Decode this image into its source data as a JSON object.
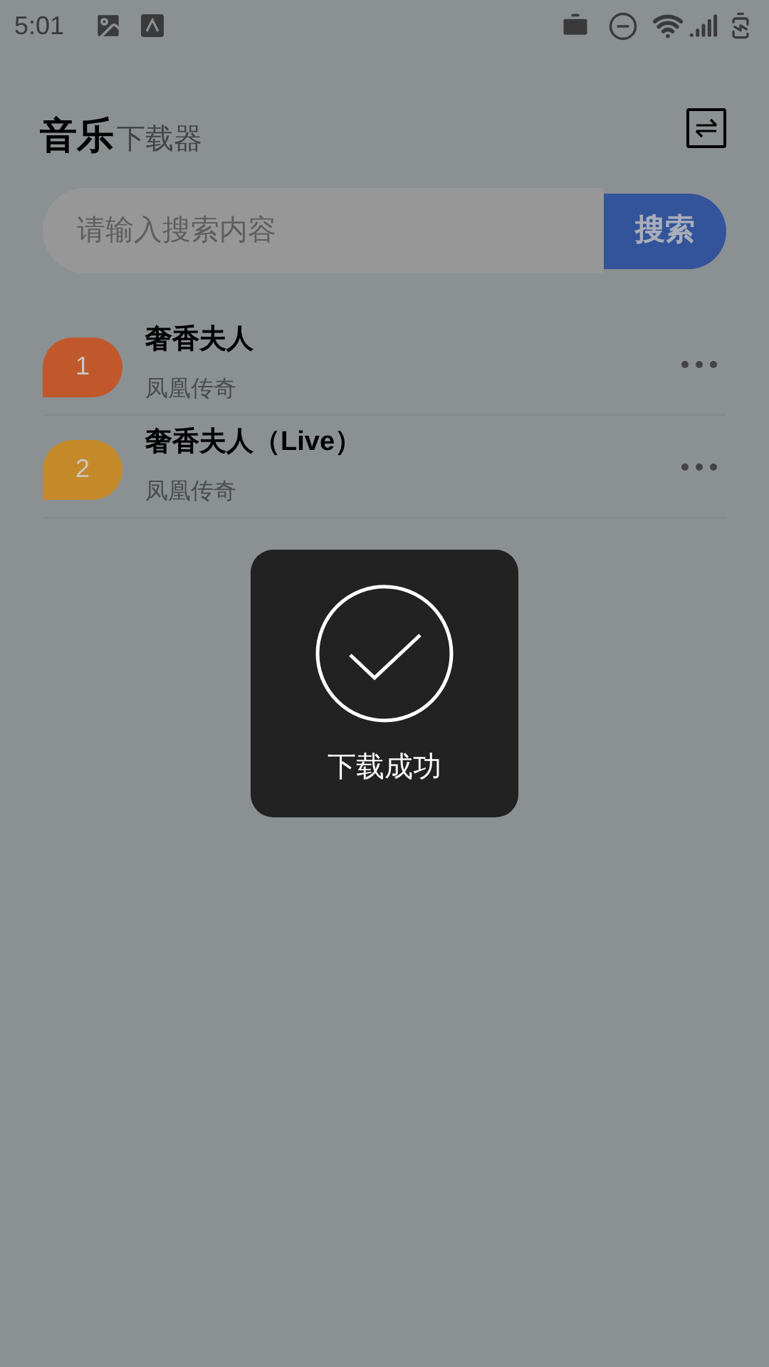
{
  "status_bar": {
    "time": "5:01"
  },
  "header": {
    "title": "音乐",
    "subtitle": "下载器"
  },
  "search": {
    "placeholder": "请输入搜索内容",
    "button": "搜索"
  },
  "songs": [
    {
      "number": "1",
      "title": "奢香夫人",
      "artist": "凤凰传奇",
      "color": "#c0582c"
    },
    {
      "number": "2",
      "title": "奢香夫人（Live）",
      "artist": "凤凰传奇",
      "color": "#c48a2a"
    }
  ],
  "toast": {
    "message": "下载成功"
  }
}
